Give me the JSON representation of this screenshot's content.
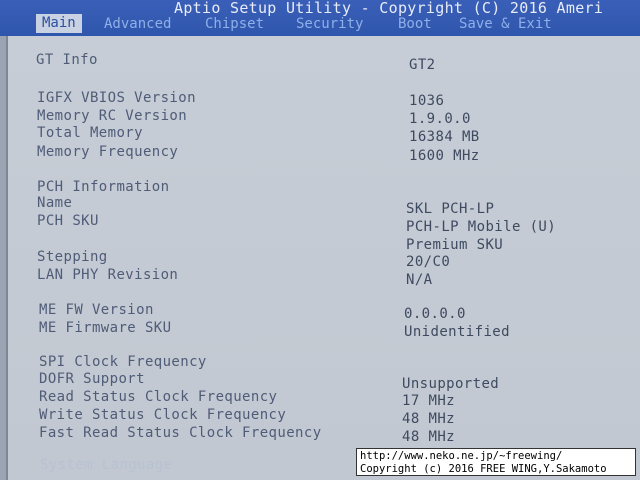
{
  "window": {
    "title": "Aptio Setup Utility - Copyright (C) 2016 Ameri",
    "tabs": [
      "Main",
      "Advanced",
      "Chipset",
      "Security",
      "Boot",
      "Save & Exit"
    ],
    "active_tab": "Main"
  },
  "colors": {
    "title_bar": "#3a5fb8",
    "panel_background": "#c7cdd6",
    "label_text": "#4f5c78",
    "active_tab_text": "#2d4f9f"
  },
  "rows": [
    {
      "label": "GT Info",
      "value": "GT2"
    },
    {
      "label": "IGFX VBIOS Version",
      "value": "1036"
    },
    {
      "label": "Memory RC Version",
      "value": "1.9.0.0"
    },
    {
      "label": "Total Memory",
      "value": "16384 MB"
    },
    {
      "label": "Memory Frequency",
      "value": "1600 MHz"
    },
    {
      "label": "PCH Information",
      "value": ""
    },
    {
      "label": "Name",
      "value": "SKL PCH-LP"
    },
    {
      "label": "PCH SKU",
      "value": "PCH-LP Mobile (U)"
    },
    {
      "label": "",
      "value": "Premium SKU"
    },
    {
      "label": "Stepping",
      "value": "20/C0"
    },
    {
      "label": "LAN PHY Revision",
      "value": "N/A"
    },
    {
      "label": "ME FW Version",
      "value": "0.0.0.0"
    },
    {
      "label": "ME Firmware SKU",
      "value": "Unidentified"
    },
    {
      "label": "SPI Clock Frequency",
      "value": ""
    },
    {
      "label": "DOFR Support",
      "value": "Unsupported"
    },
    {
      "label": "Read Status Clock Frequency",
      "value": "17 MHz"
    },
    {
      "label": "Write Status Clock Frequency",
      "value": "48 MHz"
    },
    {
      "label": "Fast Read Status Clock Frequency",
      "value": "48 MHz"
    },
    {
      "label": "System Language",
      "value": ""
    }
  ],
  "watermark": {
    "line1": "http://www.neko.ne.jp/~freewing/",
    "line2": "Copyright (c) 2016 FREE WING,Y.Sakamoto"
  }
}
